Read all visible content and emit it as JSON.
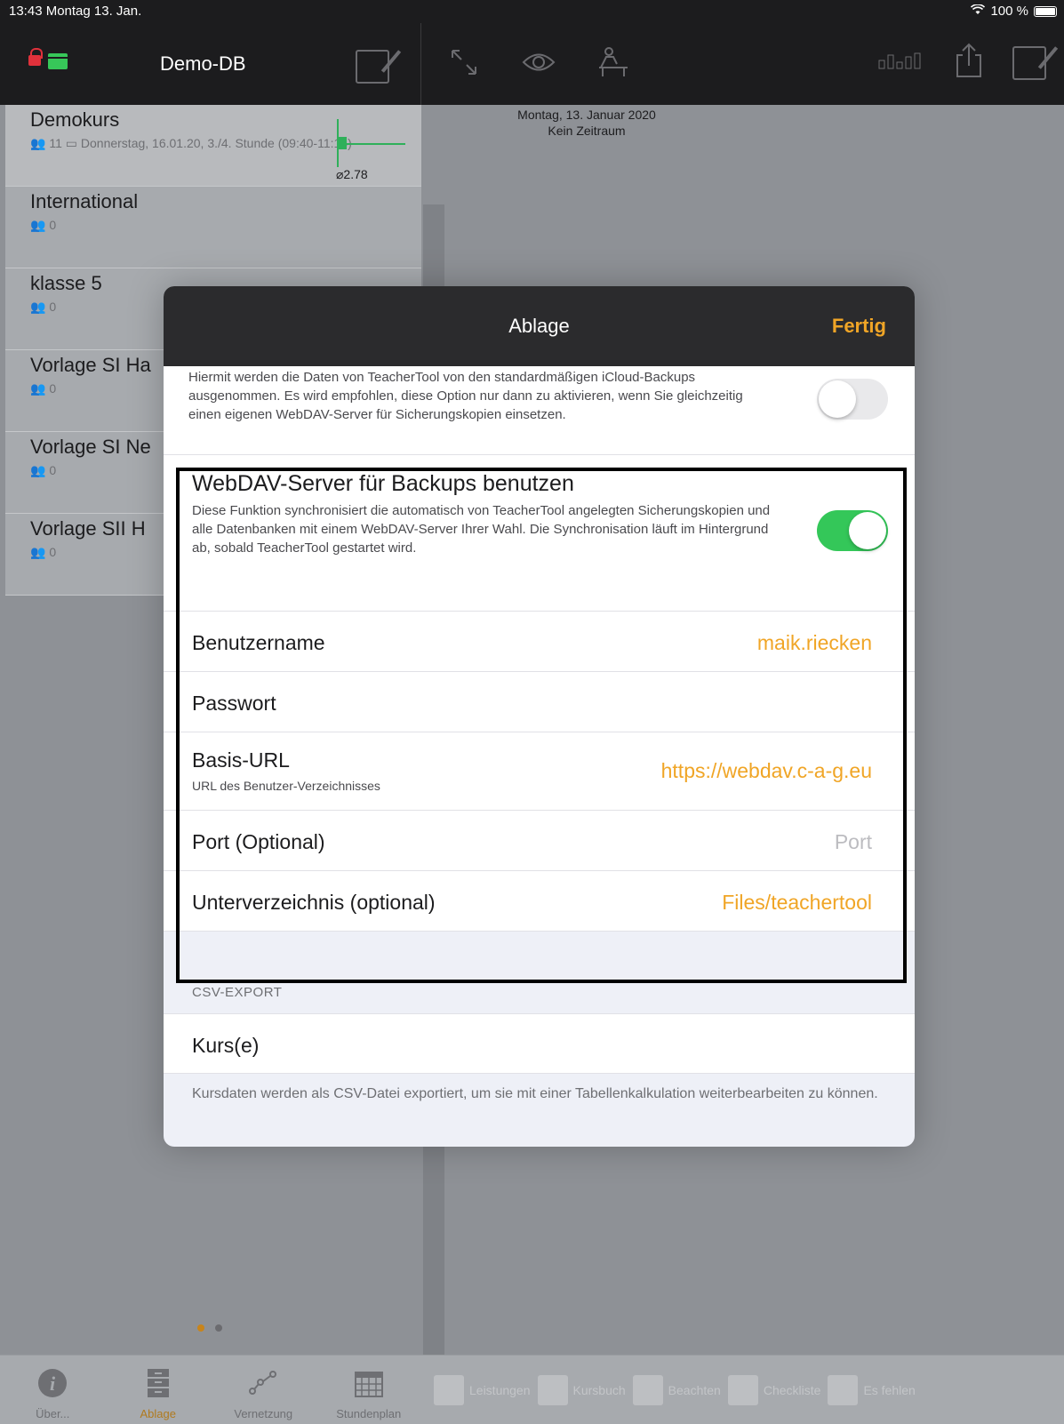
{
  "status": {
    "time": "13:43  Montag 13. Jan.",
    "battery": "100 %"
  },
  "sidebar": {
    "title": "Demo-DB",
    "courses": [
      {
        "name": "Demokurs",
        "count": "11",
        "detail": "Donnerstag, 16.01.20, 3./4. Stunde (09:40-11:15)",
        "avg": "⌀2.78"
      },
      {
        "name": "International",
        "count": "0"
      },
      {
        "name": "klasse 5",
        "count": "0"
      },
      {
        "name": "Vorlage SI Ha",
        "count": "0"
      },
      {
        "name": "Vorlage SI Ne",
        "count": "0"
      },
      {
        "name": "Vorlage SII H",
        "count": "0"
      }
    ]
  },
  "detail": {
    "date": "Montag, 13. Januar 2020",
    "range": "Kein Zeitraum"
  },
  "modal": {
    "title": "Ablage",
    "done": "Fertig",
    "icloud_desc": "Hiermit werden die Daten von TeacherTool von den standardmäßigen iCloud-Backups ausgenommen. Es wird empfohlen, diese Option nur dann zu aktivieren, wenn Sie gleichzeitig einen eigenen WebDAV-Server für Sicherungskopien einsetzen.",
    "webdav_title": "WebDAV-Server für Backups benutzen",
    "webdav_desc": "Diese Funktion synchronisiert die automatisch von TeacherTool angelegten Sicherungskopien und alle Datenbanken mit einem WebDAV-Server Ihrer Wahl. Die Synchronisation läuft im Hintergrund ab, sobald TeacherTool gestartet wird.",
    "username_label": "Benutzername",
    "username_value": "maik.riecken",
    "password_label": "Passwort",
    "baseurl_label": "Basis-URL",
    "baseurl_sub": "URL des Benutzer-Verzeichnisses",
    "baseurl_value": "https://webdav.c-a-g.eu",
    "port_label": "Port (Optional)",
    "port_placeholder": "Port",
    "subdir_label": "Unterverzeichnis (optional)",
    "subdir_value": "Files/teachertool",
    "csv_header": "CSV-EXPORT",
    "csv_item": "Kurs(e)",
    "csv_footer": "Kursdaten werden als CSV-Datei exportiert, um sie mit einer Tabellenkalkulation weiterbearbeiten zu können.",
    "icloud_toggle": false,
    "webdav_toggle": true
  },
  "tabs": [
    {
      "label": "Über...",
      "icon": "info-icon"
    },
    {
      "label": "Ablage",
      "icon": "cabinet-icon"
    },
    {
      "label": "Vernetzung",
      "icon": "network-icon"
    },
    {
      "label": "Stundenplan",
      "icon": "calendar-icon"
    }
  ],
  "tabs2": [
    "Leistungen",
    "Kursbuch",
    "Beachten",
    "Checkliste",
    "Es fehlen"
  ],
  "colors": {
    "accent": "#f0a526",
    "toggle_on": "#34c759"
  }
}
